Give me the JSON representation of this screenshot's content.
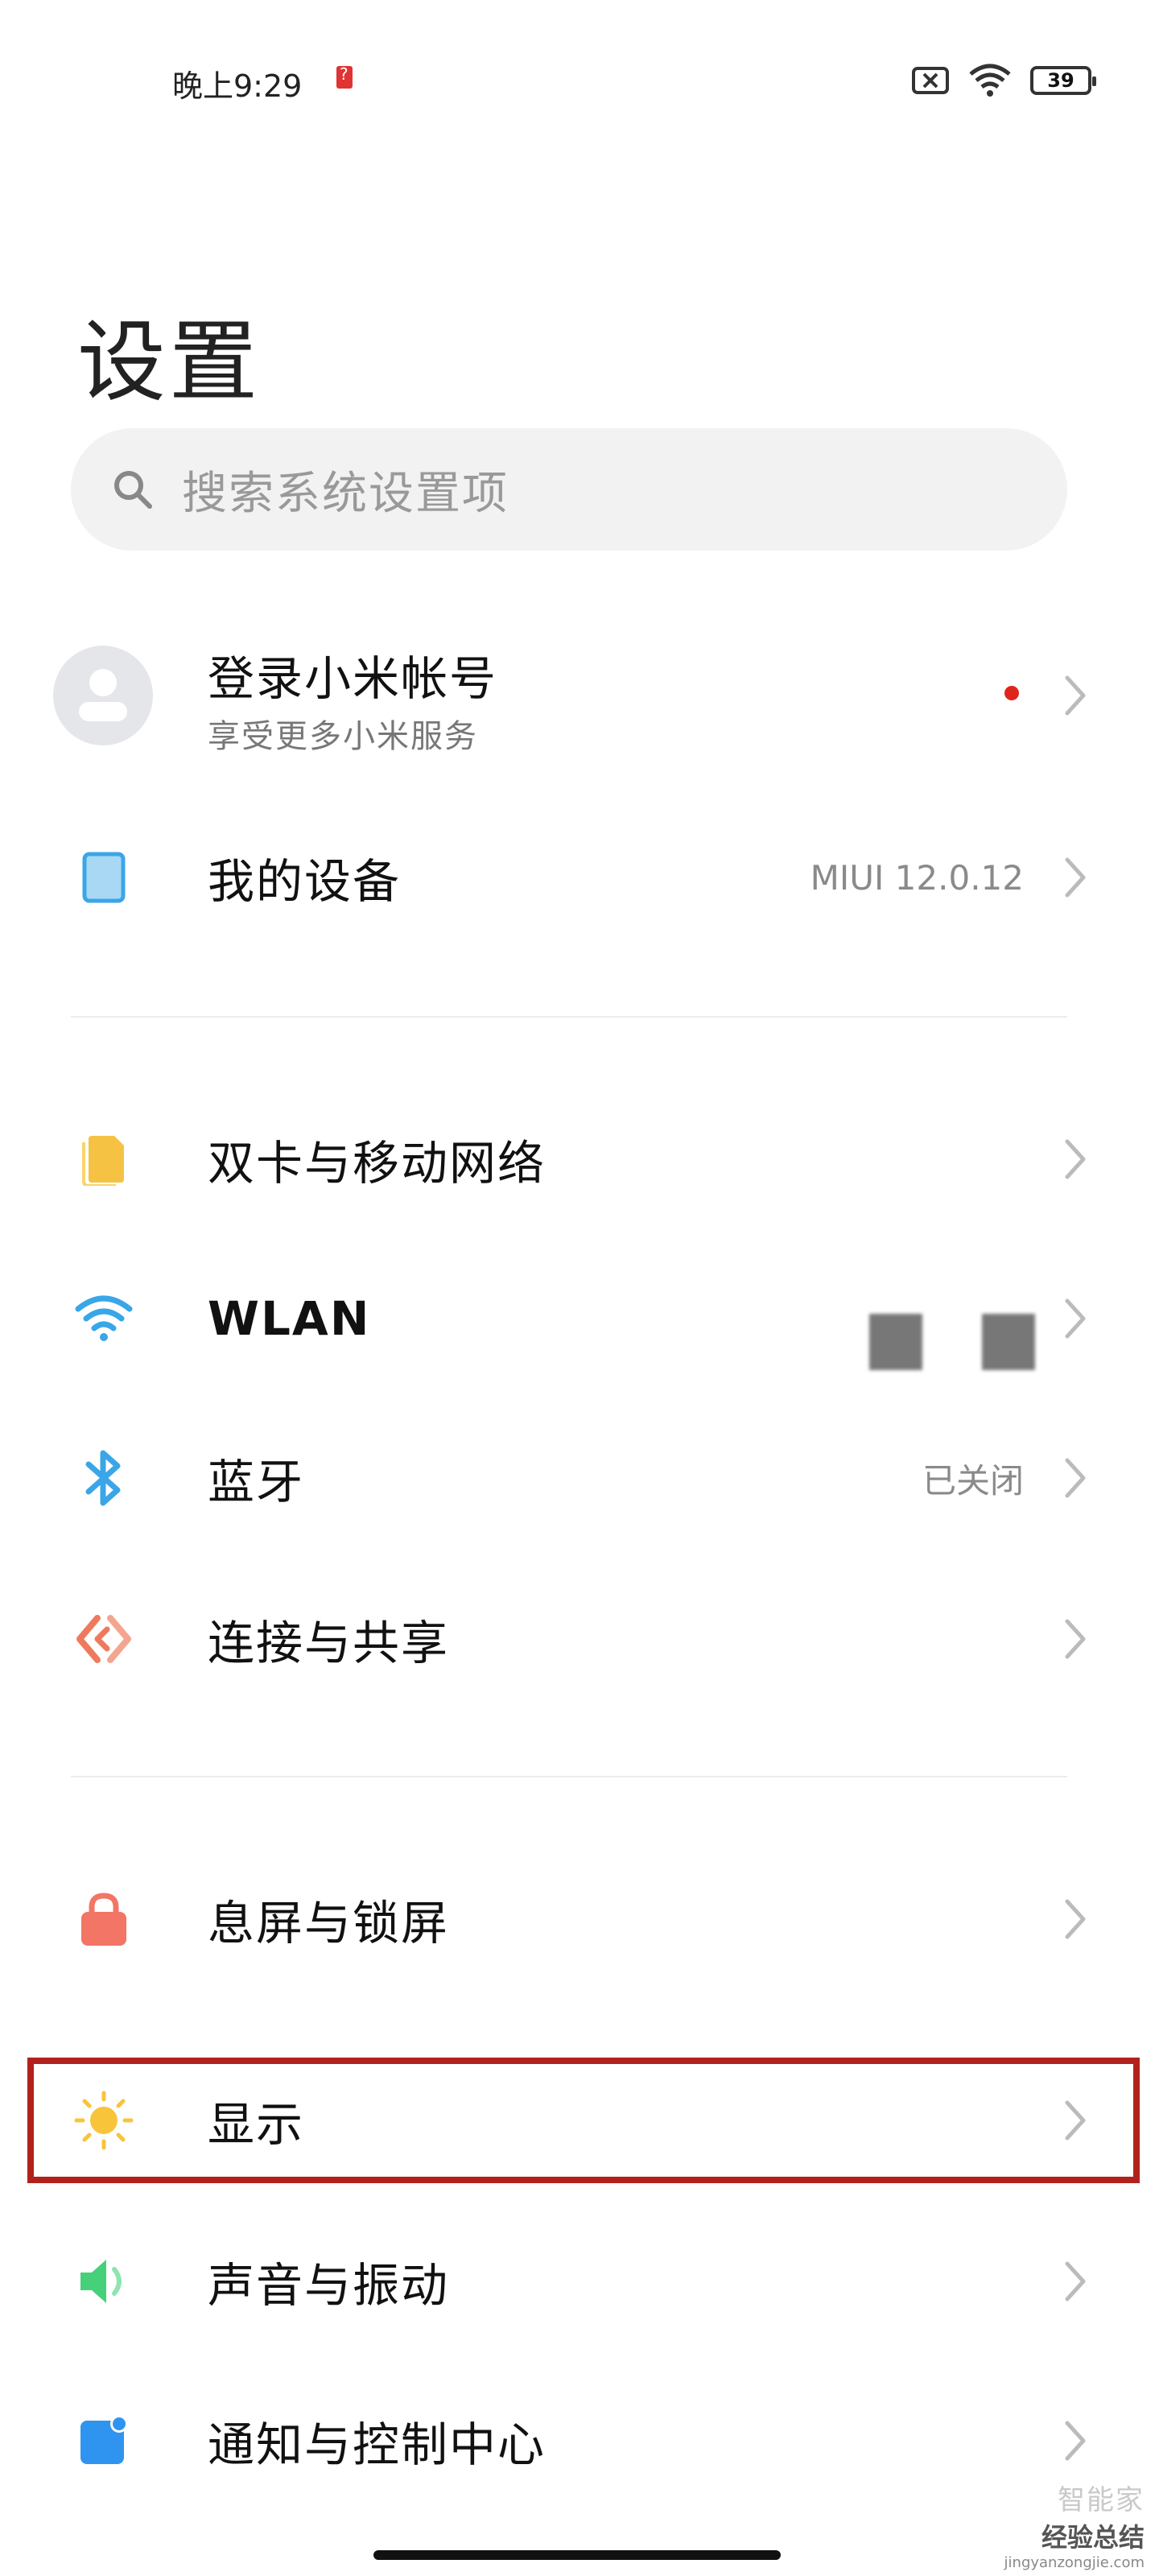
{
  "status_bar": {
    "time": "晚上9:29",
    "battery_level": "39",
    "icons": [
      "sim-unknown-icon",
      "signal-x-icon",
      "wifi-icon",
      "battery-icon"
    ]
  },
  "page": {
    "title": "设置"
  },
  "search": {
    "placeholder": "搜索系统设置项"
  },
  "account": {
    "title": "登录小米帐号",
    "subtitle": "享受更多小米服务",
    "has_notification_dot": true
  },
  "items": [
    {
      "id": "my-device",
      "label": "我的设备",
      "value": "MIUI 12.0.12",
      "icon": "tablet-icon"
    },
    {
      "id": "sim",
      "label": "双卡与移动网络",
      "value": "",
      "icon": "sim-card-icon"
    },
    {
      "id": "wlan",
      "label": "WLAN",
      "value": "",
      "icon": "wifi-icon"
    },
    {
      "id": "bluetooth",
      "label": "蓝牙",
      "value": "已关闭",
      "icon": "bluetooth-icon"
    },
    {
      "id": "connect-share",
      "label": "连接与共享",
      "value": "",
      "icon": "share-icon"
    },
    {
      "id": "lock-screen",
      "label": "息屏与锁屏",
      "value": "",
      "icon": "lock-icon"
    },
    {
      "id": "display",
      "label": "显示",
      "value": "",
      "icon": "sun-icon"
    },
    {
      "id": "sound",
      "label": "声音与振动",
      "value": "",
      "icon": "speaker-icon"
    },
    {
      "id": "notifications",
      "label": "通知与控制中心",
      "value": "",
      "icon": "notification-icon"
    }
  ],
  "watermark": {
    "top": "智能家",
    "main": "经验总结",
    "url": "jingyanzongjie.com"
  },
  "colors": {
    "highlight_border": "#b1221c",
    "notification_dot": "#e0241c",
    "sim_icon": "#f5c243",
    "wifi_icon": "#3aa6e8",
    "bluetooth_icon": "#3aa6e8",
    "share_icon": "#ee7a5e",
    "lock_icon": "#f27565",
    "sun_icon": "#f8c43a",
    "speaker_icon": "#47d07a",
    "notification_icon": "#2f94ef"
  }
}
